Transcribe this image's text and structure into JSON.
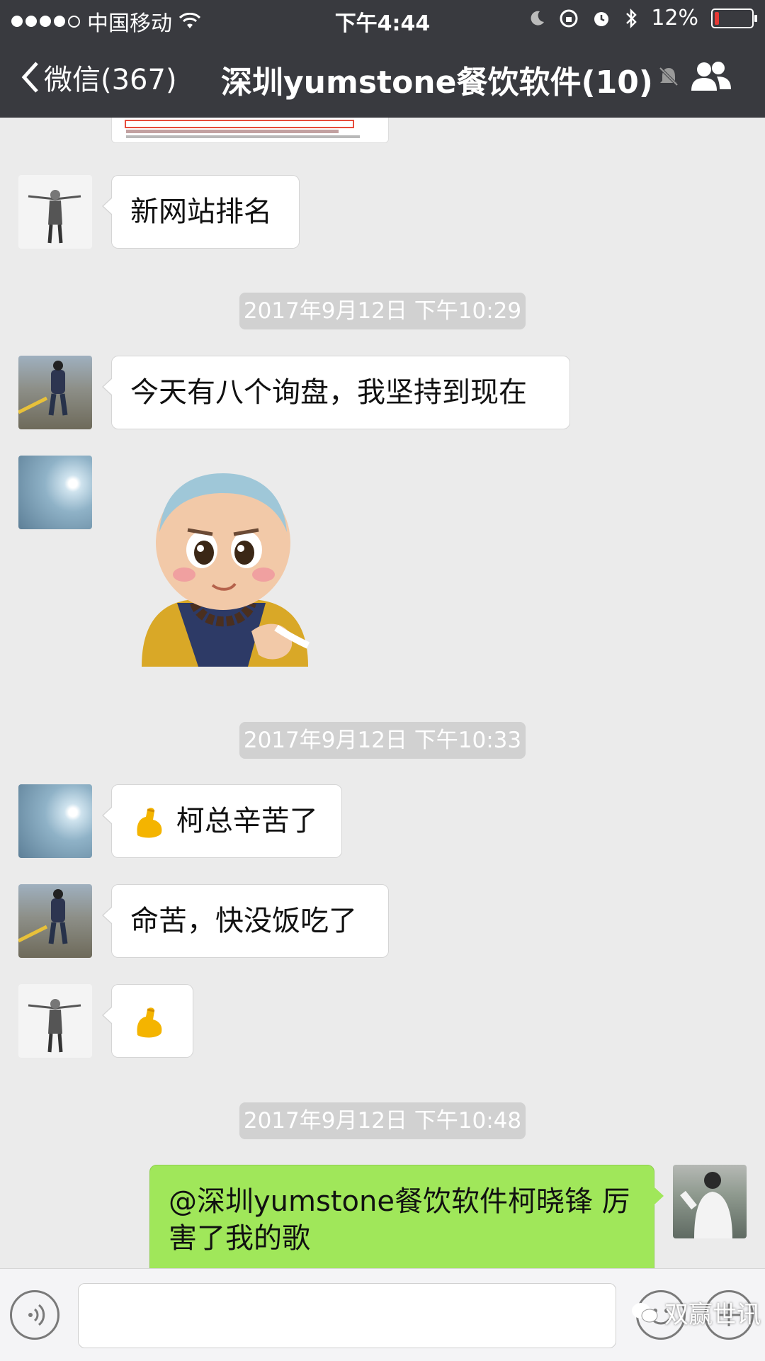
{
  "status_bar": {
    "carrier": "中国移动",
    "time": "下午4:44",
    "battery": "12%",
    "battery_level": 0.12
  },
  "header": {
    "back_label": "微信(367)",
    "title": "深圳yumstone餐饮软件(10)"
  },
  "messages": {
    "m1": "新网站排名",
    "ts1": "2017年9月12日 下午10:29",
    "m2": "今天有八个询盘，我坚持到现在",
    "ts2": "2017年9月12日 下午10:33",
    "m3": "柯总辛苦了",
    "m4": "命苦，快没饭吃了",
    "ts3": "2017年9月12日 下午10:48",
    "m5": "@深圳yumstone餐饮软件柯晓锋 厉害了我的歌"
  },
  "watermark": "双赢世讯",
  "icons": {
    "back": "chevron-left-icon",
    "mute": "bell-mute-icon",
    "members": "group-icon",
    "voice": "voice-icon",
    "emoji": "smile-icon",
    "plus": "plus-icon",
    "arm": "flexed-biceps-icon"
  },
  "colors": {
    "header_bg": "#393a3f",
    "chat_bg": "#ebebeb",
    "sent_bubble": "#a0e75a",
    "received_bubble": "#ffffff",
    "timestamp_bg": "#d1d1d1"
  }
}
